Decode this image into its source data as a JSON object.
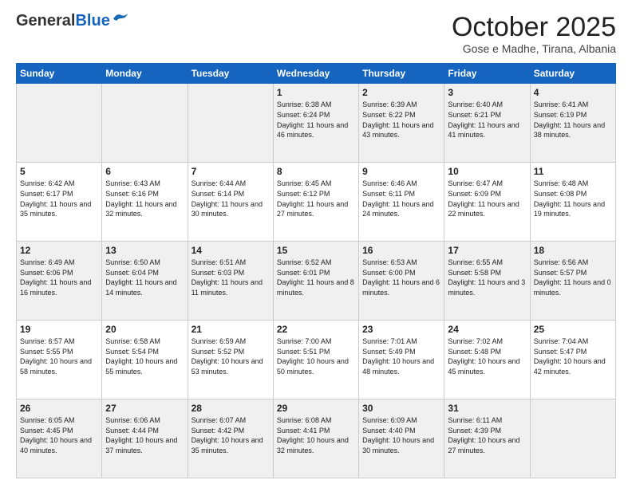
{
  "header": {
    "logo_general": "General",
    "logo_blue": "Blue",
    "month_title": "October 2025",
    "subtitle": "Gose e Madhe, Tirana, Albania"
  },
  "days_of_week": [
    "Sunday",
    "Monday",
    "Tuesday",
    "Wednesday",
    "Thursday",
    "Friday",
    "Saturday"
  ],
  "weeks": [
    [
      {
        "day": "",
        "sunrise": "",
        "sunset": "",
        "daylight": ""
      },
      {
        "day": "",
        "sunrise": "",
        "sunset": "",
        "daylight": ""
      },
      {
        "day": "",
        "sunrise": "",
        "sunset": "",
        "daylight": ""
      },
      {
        "day": "1",
        "sunrise": "6:38 AM",
        "sunset": "6:24 PM",
        "daylight": "11 hours and 46 minutes."
      },
      {
        "day": "2",
        "sunrise": "6:39 AM",
        "sunset": "6:22 PM",
        "daylight": "11 hours and 43 minutes."
      },
      {
        "day": "3",
        "sunrise": "6:40 AM",
        "sunset": "6:21 PM",
        "daylight": "11 hours and 41 minutes."
      },
      {
        "day": "4",
        "sunrise": "6:41 AM",
        "sunset": "6:19 PM",
        "daylight": "11 hours and 38 minutes."
      }
    ],
    [
      {
        "day": "5",
        "sunrise": "6:42 AM",
        "sunset": "6:17 PM",
        "daylight": "11 hours and 35 minutes."
      },
      {
        "day": "6",
        "sunrise": "6:43 AM",
        "sunset": "6:16 PM",
        "daylight": "11 hours and 32 minutes."
      },
      {
        "day": "7",
        "sunrise": "6:44 AM",
        "sunset": "6:14 PM",
        "daylight": "11 hours and 30 minutes."
      },
      {
        "day": "8",
        "sunrise": "6:45 AM",
        "sunset": "6:12 PM",
        "daylight": "11 hours and 27 minutes."
      },
      {
        "day": "9",
        "sunrise": "6:46 AM",
        "sunset": "6:11 PM",
        "daylight": "11 hours and 24 minutes."
      },
      {
        "day": "10",
        "sunrise": "6:47 AM",
        "sunset": "6:09 PM",
        "daylight": "11 hours and 22 minutes."
      },
      {
        "day": "11",
        "sunrise": "6:48 AM",
        "sunset": "6:08 PM",
        "daylight": "11 hours and 19 minutes."
      }
    ],
    [
      {
        "day": "12",
        "sunrise": "6:49 AM",
        "sunset": "6:06 PM",
        "daylight": "11 hours and 16 minutes."
      },
      {
        "day": "13",
        "sunrise": "6:50 AM",
        "sunset": "6:04 PM",
        "daylight": "11 hours and 14 minutes."
      },
      {
        "day": "14",
        "sunrise": "6:51 AM",
        "sunset": "6:03 PM",
        "daylight": "11 hours and 11 minutes."
      },
      {
        "day": "15",
        "sunrise": "6:52 AM",
        "sunset": "6:01 PM",
        "daylight": "11 hours and 8 minutes."
      },
      {
        "day": "16",
        "sunrise": "6:53 AM",
        "sunset": "6:00 PM",
        "daylight": "11 hours and 6 minutes."
      },
      {
        "day": "17",
        "sunrise": "6:55 AM",
        "sunset": "5:58 PM",
        "daylight": "11 hours and 3 minutes."
      },
      {
        "day": "18",
        "sunrise": "6:56 AM",
        "sunset": "5:57 PM",
        "daylight": "11 hours and 0 minutes."
      }
    ],
    [
      {
        "day": "19",
        "sunrise": "6:57 AM",
        "sunset": "5:55 PM",
        "daylight": "10 hours and 58 minutes."
      },
      {
        "day": "20",
        "sunrise": "6:58 AM",
        "sunset": "5:54 PM",
        "daylight": "10 hours and 55 minutes."
      },
      {
        "day": "21",
        "sunrise": "6:59 AM",
        "sunset": "5:52 PM",
        "daylight": "10 hours and 53 minutes."
      },
      {
        "day": "22",
        "sunrise": "7:00 AM",
        "sunset": "5:51 PM",
        "daylight": "10 hours and 50 minutes."
      },
      {
        "day": "23",
        "sunrise": "7:01 AM",
        "sunset": "5:49 PM",
        "daylight": "10 hours and 48 minutes."
      },
      {
        "day": "24",
        "sunrise": "7:02 AM",
        "sunset": "5:48 PM",
        "daylight": "10 hours and 45 minutes."
      },
      {
        "day": "25",
        "sunrise": "7:04 AM",
        "sunset": "5:47 PM",
        "daylight": "10 hours and 42 minutes."
      }
    ],
    [
      {
        "day": "26",
        "sunrise": "6:05 AM",
        "sunset": "4:45 PM",
        "daylight": "10 hours and 40 minutes."
      },
      {
        "day": "27",
        "sunrise": "6:06 AM",
        "sunset": "4:44 PM",
        "daylight": "10 hours and 37 minutes."
      },
      {
        "day": "28",
        "sunrise": "6:07 AM",
        "sunset": "4:42 PM",
        "daylight": "10 hours and 35 minutes."
      },
      {
        "day": "29",
        "sunrise": "6:08 AM",
        "sunset": "4:41 PM",
        "daylight": "10 hours and 32 minutes."
      },
      {
        "day": "30",
        "sunrise": "6:09 AM",
        "sunset": "4:40 PM",
        "daylight": "10 hours and 30 minutes."
      },
      {
        "day": "31",
        "sunrise": "6:11 AM",
        "sunset": "4:39 PM",
        "daylight": "10 hours and 27 minutes."
      },
      {
        "day": "",
        "sunrise": "",
        "sunset": "",
        "daylight": ""
      }
    ]
  ]
}
